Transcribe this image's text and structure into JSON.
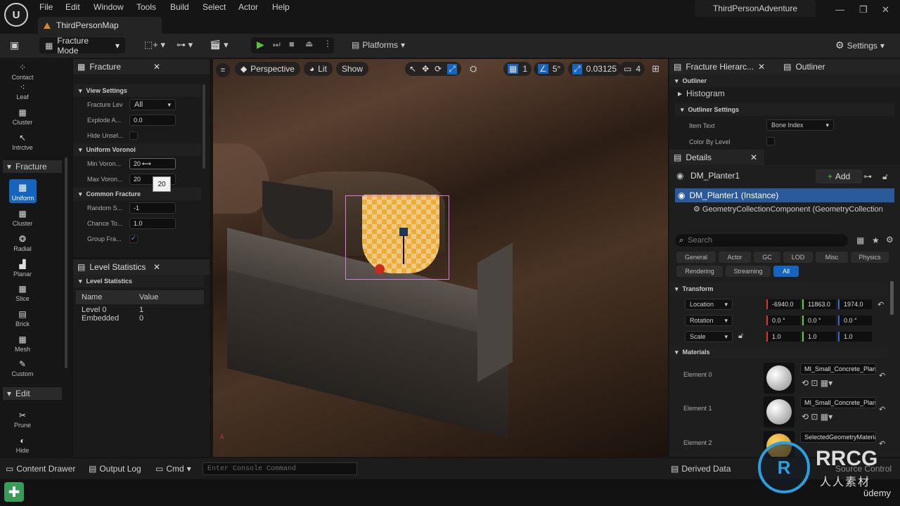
{
  "menubar": {
    "items": [
      "File",
      "Edit",
      "Window",
      "Tools",
      "Build",
      "Select",
      "Actor",
      "Help"
    ],
    "project": "ThirdPersonAdventure",
    "map_tab": "ThirdPersonMap"
  },
  "toolbar": {
    "mode": "Fracture Mode",
    "platforms": "Platforms",
    "settings": "Settings"
  },
  "left_tools": {
    "top": [
      "Contact",
      "Leaf",
      "Cluster",
      "Intrctve"
    ],
    "fracture_section": "Fracture",
    "fracture": [
      "Uniform",
      "Cluster",
      "Radial",
      "Planar",
      "Slice",
      "Brick",
      "Mesh",
      "Custom"
    ],
    "edit_section": "Edit",
    "edit": [
      "Prune",
      "Hide"
    ]
  },
  "fracture_panel": {
    "title": "Fracture",
    "view_settings": "View Settings",
    "fracture_level_label": "Fracture Lev",
    "fracture_level_value": "All",
    "explode_label": "Explode A...",
    "explode_value": "0.0",
    "hide_label": "Hide Unsel...",
    "uniform_voronoi": "Uniform Voronoi",
    "min_label": "Min Voron...",
    "min_value": "20",
    "max_label": "Max Voron...",
    "max_value": "20",
    "tooltip": "20",
    "common_fracture": "Common Fracture",
    "random_label": "Random S...",
    "random_value": "-1",
    "chance_label": "Chance To...",
    "chance_value": "1.0",
    "group_label": "Group Fra..."
  },
  "level_stats": {
    "title": "Level Statistics",
    "section": "Level Statistics",
    "col_name": "Name",
    "col_value": "Value",
    "rows": [
      {
        "name": "Level 0",
        "value": "1"
      },
      {
        "name": "Embedded",
        "value": "0"
      }
    ]
  },
  "viewport": {
    "perspective": "Perspective",
    "lit": "Lit",
    "show": "Show",
    "grid": "1",
    "angle": "5°",
    "scale": "0.03125",
    "camera": "4"
  },
  "hierarchy": {
    "tab1": "Fracture Hierarc...",
    "tab2": "Outliner",
    "outliner": "Outliner",
    "histogram": "Histogram",
    "outliner_settings": "Outliner Settings",
    "item_text_label": "Item Text",
    "item_text_value": "Bone Index",
    "color_by_level": "Color By Level"
  },
  "details": {
    "title": "Details",
    "actor": "DM_Planter1",
    "add": "Add",
    "instance": "DM_Planter1 (Instance)",
    "component": "GeometryCollectionComponent (GeometryCollection",
    "search_placeholder": "Search",
    "filters_row1": [
      "General",
      "Actor",
      "GC",
      "LOD",
      "Misc",
      "Physics"
    ],
    "filters_row2": [
      "Rendering",
      "Streaming",
      "All"
    ],
    "transform": "Transform",
    "location": {
      "label": "Location",
      "x": "-6940.0",
      "y": "11863.0",
      "z": "1974.0"
    },
    "rotation": {
      "label": "Rotation",
      "x": "0.0 °",
      "y": "0.0 °",
      "z": "0.0 °"
    },
    "scale": {
      "label": "Scale",
      "x": "1.0",
      "y": "1.0",
      "z": "1.0"
    },
    "materials": "Materials",
    "elements": [
      {
        "label": "Element 0",
        "material": "MI_Small_Concrete_Plante"
      },
      {
        "label": "Element 1",
        "material": "MI_Small_Concrete_Plante"
      },
      {
        "label": "Element 2",
        "material": "SelectedGeometryMateria"
      }
    ]
  },
  "statusbar": {
    "content_drawer": "Content Drawer",
    "output_log": "Output Log",
    "cmd": "Cmd",
    "console_placeholder": "Enter Console Command",
    "derived_data": "Derived Data",
    "source_control": "Source Control"
  },
  "watermark": {
    "brand": "RRCG",
    "sub": "人人素材",
    "udemy": "ūdemy"
  },
  "colors": {
    "accent": "#1565c0",
    "selection": "#2b5a9a",
    "fracture_mesh": "#f5a623",
    "x_axis": "#d33",
    "y_axis": "#6c3",
    "z_axis": "#36c"
  }
}
